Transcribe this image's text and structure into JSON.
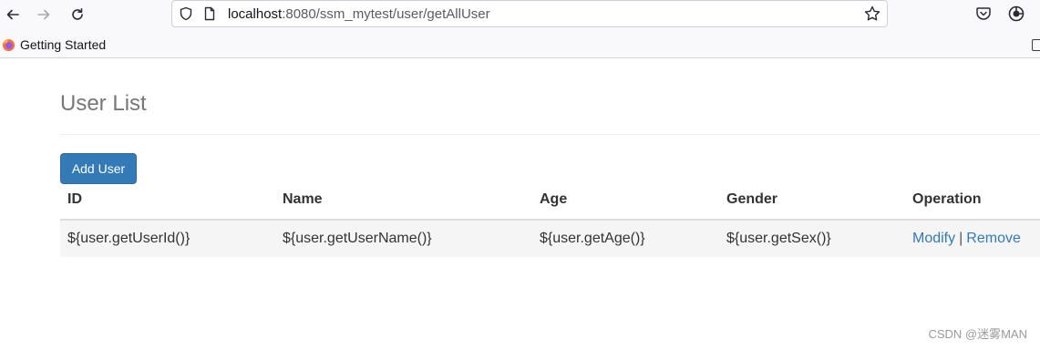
{
  "browser": {
    "url_host": "localhost",
    "url_rest": ":8080/ssm_mytest/user/getAllUser",
    "bookmark_label": "Getting Started",
    "icons": [
      "back-icon",
      "forward-icon",
      "reload-icon",
      "shield-icon",
      "page-icon",
      "star-icon",
      "pocket-icon",
      "extension-icon",
      "firefox-icon",
      "bookmark-overflow-icon"
    ]
  },
  "page": {
    "title": "User List",
    "add_button": "Add User",
    "table": {
      "headers": [
        "ID",
        "Name",
        "Age",
        "Gender",
        "Operation"
      ],
      "rows": [
        {
          "id": "${user.getUserId()}",
          "name": "${user.getUserName()}",
          "age": "${user.getAge()}",
          "gender": "${user.getSex()}",
          "modify": "Modify",
          "separator": "|",
          "remove": "Remove"
        }
      ]
    }
  },
  "watermark": "CSDN @迷雾MAN",
  "colors": {
    "primary": "#337ab7",
    "header_text": "#777777",
    "row_bg": "#f5f5f5"
  }
}
